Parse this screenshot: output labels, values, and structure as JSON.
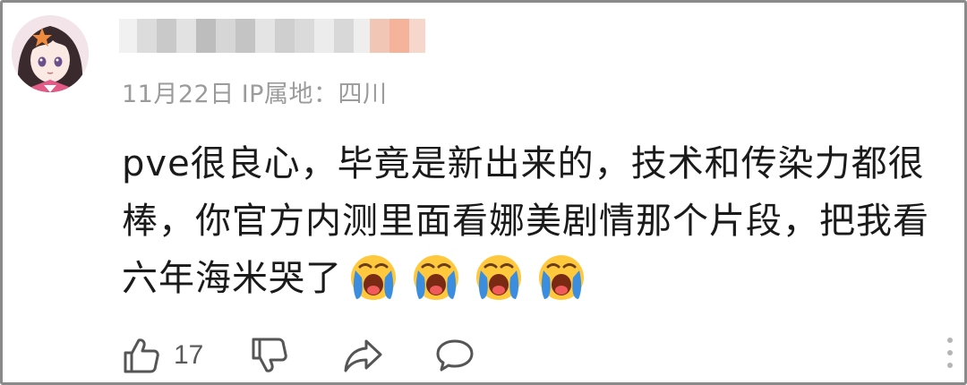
{
  "comment": {
    "date": "11月22日",
    "ip_label": "IP属地：四川",
    "content_lines": [
      "pve很良心，毕竟是新出来的，技术和传染力都很",
      "棒，你官方内测里面看娜美剧情那个片段，把我看",
      "六年海米哭了"
    ],
    "emojis": [
      "crying-face-icon",
      "crying-face-icon",
      "crying-face-icon",
      "crying-face-icon"
    ],
    "like_count": "17"
  },
  "icons": {
    "like": "thumbs-up-icon",
    "dislike": "thumbs-down-icon",
    "share": "share-arrow-icon",
    "reply": "speech-bubble-icon",
    "more": "vertical-dots-icon"
  },
  "colors": {
    "meta_text": "#9b9b9b",
    "body_text": "#1a1a1a",
    "icon_stroke": "#555555",
    "border": "#8a8a8a"
  }
}
